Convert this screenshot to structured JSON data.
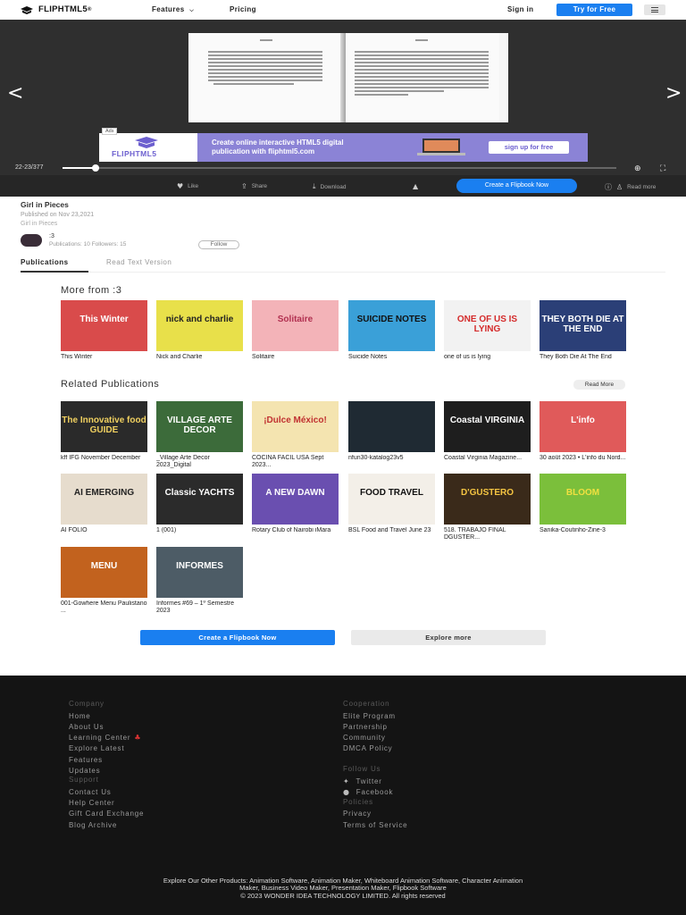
{
  "nav": {
    "brand": "FLIPHTML5",
    "brand_reg": "®",
    "features": "Features",
    "pricing": "Pricing",
    "signin": "Sign in",
    "try_free": "Try for Free"
  },
  "viewer": {
    "page_counter": "22-23/377",
    "progress": 0.06,
    "ad": {
      "tag": "Ads",
      "brand": "FLIPHTML5",
      "line1": "Create online interactive HTML5 digital",
      "line2": "publication with fliphtml5.com",
      "cta": "sign up for free"
    },
    "actions": {
      "like": "Like",
      "share": "Share",
      "download": "Download",
      "create": "Create a Flipbook Now",
      "read_more": "Read more"
    }
  },
  "doc": {
    "title": "Girl in Pieces",
    "published": "Published on Nov 23,2021",
    "subtitle": "Girl in Pieces"
  },
  "author": {
    "name": ":3",
    "stats": "Publications: 10     Followers: 15",
    "follow": "Follow"
  },
  "tabs": [
    "Publications",
    "Read Text Version"
  ],
  "more_from": {
    "title": "More from :3",
    "items": [
      {
        "caption": "This Winter",
        "cover_text": "This Winter",
        "bg": "#d94b4b",
        "fg": "#fff"
      },
      {
        "caption": "Nick and Charlie",
        "cover_text": "nick and charlie",
        "bg": "#e8e04a",
        "fg": "#222"
      },
      {
        "caption": "Solitaire",
        "cover_text": "Solitaire",
        "bg": "#f3b3b8",
        "fg": "#b13050"
      },
      {
        "caption": "Suicide Notes",
        "cover_text": "SUICIDE NOTES",
        "bg": "#3aa0d8",
        "fg": "#111"
      },
      {
        "caption": "one of us is lying",
        "cover_text": "ONE OF US IS LYING",
        "bg": "#f2f2f2",
        "fg": "#d42a2a"
      },
      {
        "caption": "They Both Die At The End",
        "cover_text": "THEY BOTH DIE AT THE END",
        "bg": "#2b3f77",
        "fg": "#fff"
      }
    ]
  },
  "related": {
    "title": "Related Publications",
    "read_more": "Read More",
    "items": [
      {
        "caption": "kff IFG November December",
        "cover_text": "The Innovative food GUIDE",
        "bg": "#2a2a2a",
        "fg": "#f0d060"
      },
      {
        "caption": "_Village Arte Decor 2023_Digital",
        "cover_text": "VILLAGE ARTE DECOR",
        "bg": "#3c6b3a",
        "fg": "#fff"
      },
      {
        "caption": "COCINA FACIL USA Sept 2023...",
        "cover_text": "¡Dulce México!",
        "bg": "#f4e4b0",
        "fg": "#c03030"
      },
      {
        "caption": "nfun30-katalog23v5",
        "cover_text": "",
        "bg": "#1f2a33",
        "fg": "#fff"
      },
      {
        "caption": "Coastal Virginia Magazine...",
        "cover_text": "Coastal VIRGINIA",
        "bg": "#1e1e1e",
        "fg": "#fff"
      },
      {
        "caption": "30 août 2023 • L'info du Nord...",
        "cover_text": "L'info",
        "bg": "#e05a5a",
        "fg": "#fff"
      },
      {
        "caption": "AI FOLIO",
        "cover_text": "AI EMERGING",
        "bg": "#e6dccd",
        "fg": "#222"
      },
      {
        "caption": "1 (001)",
        "cover_text": "Classic YACHTS",
        "bg": "#2b2b2b",
        "fg": "#fff"
      },
      {
        "caption": "Rotary Club of Nairobi iMara",
        "cover_text": "A NEW DAWN",
        "bg": "#6a4fb0",
        "fg": "#fff"
      },
      {
        "caption": "BSL Food and Travel June 23",
        "cover_text": "FOOD TRAVEL",
        "bg": "#f3efe8",
        "fg": "#111"
      },
      {
        "caption": "518. TRABAJO FINAL DGUSTER...",
        "cover_text": "D'GUSTERO",
        "bg": "#3a2a1a",
        "fg": "#f5c542"
      },
      {
        "caption": "Sanika-Coutinho-Zine-3",
        "cover_text": "BLOOM",
        "bg": "#7bbf3b",
        "fg": "#f0e040"
      },
      {
        "caption": "001-Gowhere Menu Paulistano ...",
        "cover_text": "MENU",
        "bg": "#c2621e",
        "fg": "#fff"
      },
      {
        "caption": "Informes #69 – 1º Semestre 2023",
        "cover_text": "INFORMES",
        "bg": "#4d5c66",
        "fg": "#fff"
      }
    ]
  },
  "cta": {
    "create": "Create a Flipbook Now",
    "explore": "Explore more"
  },
  "footer": {
    "company": {
      "heading": "Company",
      "links": [
        "Home",
        "About Us",
        "Learning Center",
        "Explore Latest",
        "Features",
        "Updates"
      ]
    },
    "support": {
      "heading": "Support",
      "links": [
        "Contact Us",
        "Help Center",
        "Gift Card Exchange",
        "Blog Archive"
      ]
    },
    "cooperation": {
      "heading": "Cooperation",
      "links": [
        "Elite Program",
        "Partnership",
        "Community",
        "DMCA Policy"
      ]
    },
    "follow": {
      "heading": "Follow Us",
      "links": [
        "Twitter",
        "Facebook"
      ]
    },
    "policies": {
      "heading": "Policies",
      "links": [
        "Privacy",
        "Terms of Service"
      ]
    },
    "products_line1": "Explore Our Other Products: Animation Software, Animation Maker, Whiteboard Animation Software, Character Animation",
    "products_line2": "Maker, Business Video Maker, Presentation Maker, Flipbook Software",
    "copyright": "© 2023 WONDER IDEA TECHNOLOGY LIMITED. All rights reserved"
  }
}
